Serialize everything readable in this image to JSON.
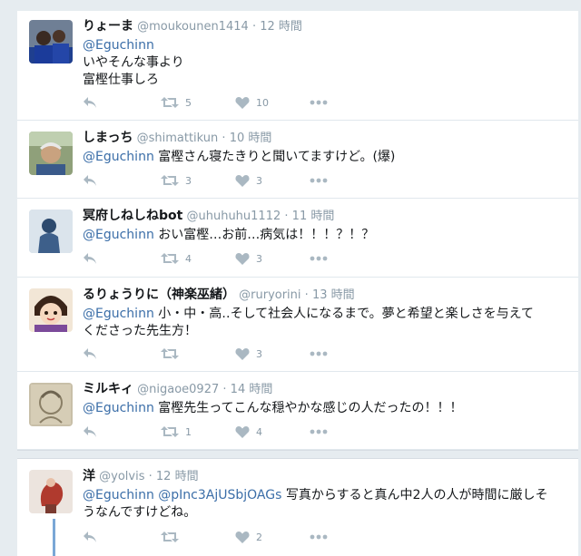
{
  "tweets": [
    {
      "name": "りょーま",
      "handle": "@moukounen1414",
      "time": "12 時間",
      "lines": [
        {
          "mention": "@Eguchinn",
          "text": ""
        },
        {
          "mention": "",
          "text": "いやそんな事より"
        },
        {
          "mention": "",
          "text": "富樫仕事しろ"
        }
      ],
      "retweets": "5",
      "likes": "10"
    },
    {
      "name": "しまっち",
      "handle": "@shimattikun",
      "time": "10 時間",
      "lines": [
        {
          "mention": "@Eguchinn",
          "text": " 富樫さん寝たきりと聞いてますけど。(爆)"
        }
      ],
      "retweets": "3",
      "likes": "3"
    },
    {
      "name": "冥府しねしねbot",
      "handle": "@uhuhuhu1112",
      "time": "11 時間",
      "lines": [
        {
          "mention": "@Eguchinn",
          "text": " おい富樫…お前…病気は！！！？！？"
        }
      ],
      "retweets": "4",
      "likes": "3"
    },
    {
      "name": "るりょうりに（神楽巫緒）",
      "handle": "@ruryorini",
      "time": "13 時間",
      "lines": [
        {
          "mention": "@Eguchinn",
          "text": " 小・中・高‥そして社会人になるまで。夢と希望と楽しさを与えて"
        },
        {
          "mention": "",
          "text": "くださった先生方！"
        }
      ],
      "retweets": "",
      "likes": "3"
    },
    {
      "name": "ミルキィ",
      "handle": "@nigaoe0927",
      "time": "14 時間",
      "lines": [
        {
          "mention": "@Eguchinn",
          "text": " 富樫先生ってこんな穏やかな感じの人だったの！！！"
        }
      ],
      "retweets": "1",
      "likes": "4"
    },
    {
      "name": "洋",
      "handle": "@yolvis",
      "time": "12 時間",
      "lines": [
        {
          "mention": "@Eguchinn @pInc3AjUSbjOAGs",
          "text": " 写真からすると真ん中2人の人が時間に厳しそ"
        },
        {
          "mention": "",
          "text": "うなんですけどね。"
        }
      ],
      "retweets": "",
      "likes": "2"
    }
  ],
  "colors": {
    "mention": "#3b6ea8",
    "meta": "#8899a6",
    "icon": "#aab8c2"
  },
  "icons": [
    "reply-icon",
    "retweet-icon",
    "like-icon",
    "more-icon"
  ]
}
